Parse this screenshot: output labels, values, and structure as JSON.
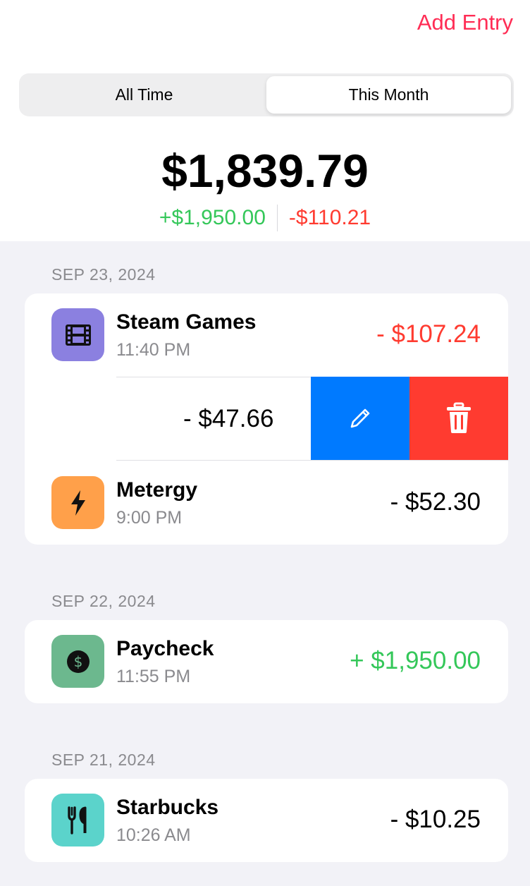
{
  "header": {
    "add_entry_label": "Add Entry"
  },
  "segmented": {
    "options": [
      "All Time",
      "This Month"
    ],
    "selected": "This Month"
  },
  "summary": {
    "total": "$1,839.79",
    "income": "+$1,950.00",
    "expense": "-$110.21"
  },
  "colors": {
    "accent": "#ff2d55",
    "income": "#34c759",
    "expense": "#ff3b30",
    "edit_action": "#007aff",
    "delete_action": "#ff3b30"
  },
  "groups": [
    {
      "date": "SEP 23, 2024",
      "entries": [
        {
          "title": "Steam Games",
          "time": "11:40 PM",
          "amount": "- $107.24",
          "amount_type": "expense-red",
          "icon": "film-icon",
          "icon_bg": "#8b80e0"
        },
        {
          "amount": "- $47.66",
          "swiped": true,
          "actions": [
            "edit",
            "delete"
          ]
        },
        {
          "title": "Metergy",
          "time": "9:00 PM",
          "amount": "- $52.30",
          "amount_type": "expense",
          "icon": "bolt-icon",
          "icon_bg": "#ffa04a"
        }
      ]
    },
    {
      "date": "SEP 22, 2024",
      "entries": [
        {
          "title": "Paycheck",
          "time": "11:55 PM",
          "amount": "+ $1,950.00",
          "amount_type": "income",
          "icon": "dollar-circle-icon",
          "icon_bg": "#6cb88e"
        }
      ]
    },
    {
      "date": "SEP 21, 2024",
      "entries": [
        {
          "title": "Starbucks",
          "time": "10:26 AM",
          "amount": "- $10.25",
          "amount_type": "expense",
          "icon": "fork-knife-icon",
          "icon_bg": "#5bd3cb"
        }
      ]
    }
  ]
}
